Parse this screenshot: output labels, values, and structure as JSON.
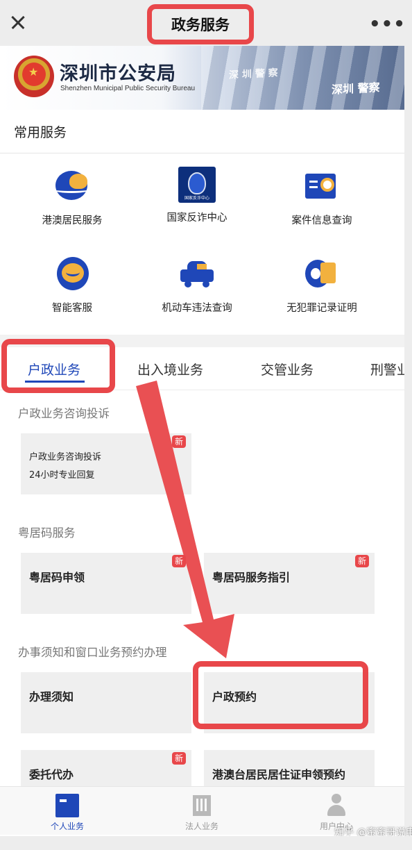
{
  "topbar": {
    "title": "政务服务",
    "more": "•••"
  },
  "banner": {
    "name": "深圳市公安局",
    "name_en": "Shenzhen Municipal Public Security Bureau",
    "sign1": "深 圳 警 察",
    "sign2": "深圳 警察"
  },
  "common_services": {
    "title": "常用服务",
    "items": [
      {
        "label": "港澳居民服务",
        "icon": "hk-macau-resident-icon"
      },
      {
        "label": "国家反诈中心",
        "icon": "anti-fraud-center-icon",
        "icon_text": "国家反诈中心"
      },
      {
        "label": "案件信息查询",
        "icon": "case-search-icon"
      },
      {
        "label": "智能客服",
        "icon": "smart-support-icon"
      },
      {
        "label": "机动车违法查询",
        "icon": "vehicle-violation-icon"
      },
      {
        "label": "无犯罪记录证明",
        "icon": "no-criminal-record-icon"
      }
    ]
  },
  "tabs": [
    "户政业务",
    "出入境业务",
    "交管业务",
    "刑警业"
  ],
  "groups": [
    {
      "title": "户政业务咨询投诉"
    },
    {
      "title": "粤居码服务"
    },
    {
      "title": "办事须知和窗口业务预约办理"
    }
  ],
  "cards": {
    "consult_line1": "户政业务咨询投诉",
    "consult_line2": "24小时专业回复",
    "yjm_apply": "粤居码申领",
    "yjm_guide": "粤居码服务指引",
    "notice": "办理须知",
    "appointment": "户政预约",
    "proxy": "委托代办",
    "hmt_permit": "港澳台居民居住证申领预约",
    "badge": "新"
  },
  "bottom_nav": [
    {
      "label": "个人业务",
      "icon": "personal-business-icon"
    },
    {
      "label": "法人业务",
      "icon": "corporate-business-icon"
    },
    {
      "label": "用户中心",
      "icon": "user-center-icon"
    }
  ],
  "watermark": "知乎 @蜜蜜哥说电讯",
  "colors": {
    "accent": "#1f47b8",
    "highlight": "#e8474a",
    "badge": "#e8474a",
    "icon_yellow": "#f2b13e"
  }
}
